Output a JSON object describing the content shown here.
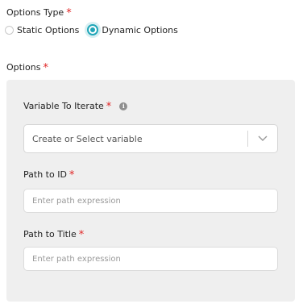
{
  "options_type": {
    "label": "Options Type",
    "required_mark": "*",
    "radios": [
      {
        "label": "Static Options",
        "checked": false
      },
      {
        "label": "Dynamic Options",
        "checked": true
      }
    ]
  },
  "options": {
    "label": "Options",
    "required_mark": "*",
    "variable_field": {
      "label": "Variable To Iterate",
      "required_mark": "*",
      "info_icon": "info-icon",
      "select_value": "Create or Select variable",
      "chevron_icon": "chevron-down-icon"
    },
    "path_to_id": {
      "label": "Path to ID",
      "required_mark": "*",
      "placeholder": "Enter path expression"
    },
    "path_to_title": {
      "label": "Path to Title",
      "required_mark": "*",
      "placeholder": "Enter path expression"
    }
  },
  "colors": {
    "accent": "#20a6b8",
    "required": "#e02424",
    "panel_bg": "#efefef"
  }
}
